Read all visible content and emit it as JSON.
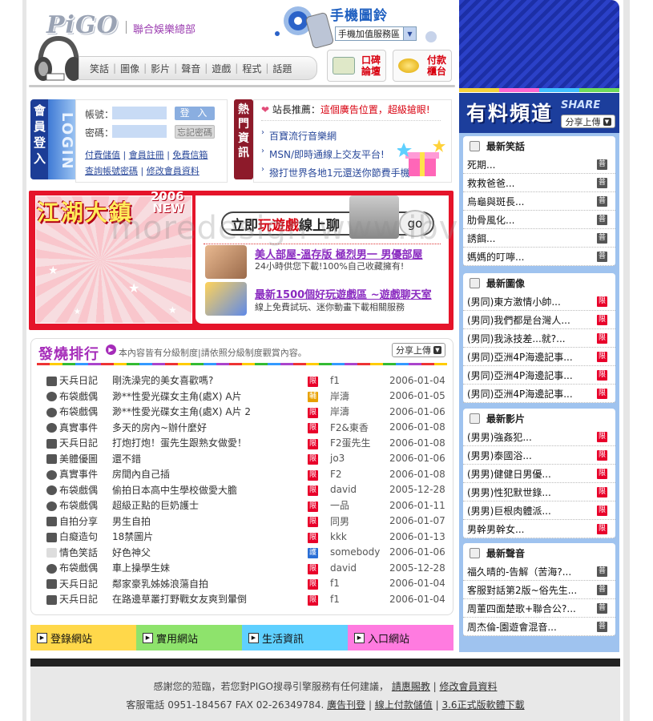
{
  "brand": {
    "logo": "PiGO",
    "tagline": "聯合娛樂總部"
  },
  "nav": [
    "笑話",
    "圖像",
    "影片",
    "聲音",
    "遊戲",
    "程式",
    "話題"
  ],
  "mobile": {
    "title": "手機圖鈴",
    "select": "手機加值服務區"
  },
  "header_buttons": [
    {
      "label": "口碑\n論壇"
    },
    {
      "label": "付款\n櫃台"
    }
  ],
  "login": {
    "vert_cn": "會員登入",
    "vert_en": "LOGIN",
    "account_label": "帳號：",
    "password_label": "密碼：",
    "login_btn": "登 入",
    "forgot_btn": "忘記密碼",
    "links_row1": [
      "付費儲值",
      "會員註冊",
      "免費信箱"
    ],
    "links_row2": [
      "查詢帳號密碼",
      "修改會員資料"
    ]
  },
  "hot": {
    "vert": "熱門資訊",
    "head_prefix": "站長推薦：",
    "head_red": "這個廣告位置，超級搶眼!",
    "items": [
      "百寶流行音樂網",
      "MSN/即時通線上交友平台!",
      "撥打世界各地1元還送你節費手機"
    ]
  },
  "jianghu": {
    "title": "江湖大鎮",
    "year": "2006",
    "new": "NEW",
    "slogan_pre": "立即",
    "slogan_red": "玩遊戲",
    "slogan_post": "線上聊",
    "go": "go",
    "watermark": "moredesign www.ibvvdm.us",
    "item1_title": "美人部屋-溫存版 極烈男一 男優部屋",
    "item1_sub": "24小時供您下載!100%自己收藏擁有!",
    "item2_title": "最新1500個好玩遊戲區 ~遊戲聊天室",
    "item2_sub": "線上免費試玩、迷你動畫下載相關服務"
  },
  "rank": {
    "title": "發燒排行",
    "note": "本內容皆有分級制度|請依照分級制度觀賞內容。",
    "share": "分享上傳",
    "rows": [
      {
        "cat": "天兵日記",
        "title": "剛洗澡完的美女喜歡嗎?",
        "tag": "限",
        "author": "f1",
        "date": "2006-01-04"
      },
      {
        "cat": "布袋戲偶",
        "title": "渺**性愛光碟女主角(處X) A片",
        "tag": "輔",
        "author": "岸濤",
        "date": "2006-01-05"
      },
      {
        "cat": "布袋戲偶",
        "title": "渺**性愛光碟女主角(處X) A片 2",
        "tag": "限",
        "author": "岸濤",
        "date": "2006-01-06"
      },
      {
        "cat": "真實事件",
        "title": "多天的房內~辦什麼好",
        "tag": "限",
        "author": "F2&東香",
        "date": "2006-01-08"
      },
      {
        "cat": "天兵日記",
        "title": "打炮打炮！蛋先生跟熟女做愛！",
        "tag": "限",
        "author": "F2蛋先生",
        "date": "2006-01-08"
      },
      {
        "cat": "美體優圖",
        "title": "還不錯",
        "tag": "限",
        "author": "jo3",
        "date": "2006-01-06"
      },
      {
        "cat": "真實事件",
        "title": "房間內自己插",
        "tag": "限",
        "author": "F2",
        "date": "2006-01-08"
      },
      {
        "cat": "布袋戲偶",
        "title": "偷拍日本高中生學校做愛大膽",
        "tag": "限",
        "author": "david",
        "date": "2005-12-28"
      },
      {
        "cat": "布袋戲偶",
        "title": "超級正點的巨奶護士",
        "tag": "限",
        "author": "一品",
        "date": "2006-01-11"
      },
      {
        "cat": "自拍分享",
        "title": "男生自拍",
        "tag": "限",
        "author": "同男",
        "date": "2006-01-07"
      },
      {
        "cat": "白癡造句",
        "title": "18禁圖片",
        "tag": "限",
        "author": "kkk",
        "date": "2006-01-13"
      },
      {
        "cat": "情色笑話",
        "title": "好色神父",
        "tag": "護",
        "author": "somebody",
        "date": "2006-01-06"
      },
      {
        "cat": "布袋戲偶",
        "title": "車上操學生妹",
        "tag": "限",
        "author": "david",
        "date": "2005-12-28"
      },
      {
        "cat": "天兵日記",
        "title": "鄰家豪乳姊姊浪蕩自拍",
        "tag": "限",
        "author": "f1",
        "date": "2006-01-04"
      },
      {
        "cat": "天兵日記",
        "title": "在路邊草叢打野戰女友爽到暈倒",
        "tag": "限",
        "author": "f1",
        "date": "2006-01-04"
      }
    ]
  },
  "link_bar": [
    "登錄網站",
    "實用網站",
    "生活資訊",
    "入口網站"
  ],
  "footer": {
    "line1_text": "感謝您的蒞臨，若您對PIGO搜尋引擎服務有任何建議，",
    "line1_links": [
      "請惠賜教",
      "修改會員資料"
    ],
    "line2_text": "客服電話 0951-184567  FAX 02-26349784.",
    "line2_links": [
      "廣告刊登",
      "線上付款儲值",
      "3.6正式版軟體下載"
    ]
  },
  "channel": {
    "title": "有料頻道",
    "share_en": "SHARE",
    "share": "分享上傳",
    "sections": [
      {
        "title": "最新笑話",
        "items": [
          {
            "t": "死期...",
            "tag": "普"
          },
          {
            "t": "救救爸爸...",
            "tag": "普"
          },
          {
            "t": "烏龜與斑長...",
            "tag": "普"
          },
          {
            "t": "肋骨風化...",
            "tag": "普"
          },
          {
            "t": "誘餌...",
            "tag": "普"
          },
          {
            "t": "媽媽的叮嚀...",
            "tag": "普"
          }
        ]
      },
      {
        "title": "最新圖像",
        "items": [
          {
            "t": "(男同)東方激情小帥...",
            "tag": "限"
          },
          {
            "t": "(男同)我們都是台灣人...",
            "tag": "限"
          },
          {
            "t": "(男同)我泳技差...就?...",
            "tag": "限"
          },
          {
            "t": "(男同)亞洲4P海邊記事...",
            "tag": "限"
          },
          {
            "t": "(男同)亞洲4P海邊記事...",
            "tag": "限"
          },
          {
            "t": "(男同)亞洲4P海邊記事...",
            "tag": "限"
          }
        ]
      },
      {
        "title": "最新影片",
        "items": [
          {
            "t": "(男男)強姦犯...",
            "tag": "限"
          },
          {
            "t": "(男男)泰國浴...",
            "tag": "限"
          },
          {
            "t": "(男男)健健日男優...",
            "tag": "限"
          },
          {
            "t": "(男男)性犯默世錄...",
            "tag": "限"
          },
          {
            "t": "(男男)巨根肉體派...",
            "tag": "限"
          },
          {
            "t": "男幹男幹女...",
            "tag": "限"
          }
        ]
      },
      {
        "title": "最新聲音",
        "items": [
          {
            "t": "福久晴的-告解（苦海?...",
            "tag": "普"
          },
          {
            "t": "客服對話第2版~俗先生...",
            "tag": "普"
          },
          {
            "t": "周董四面楚歌+聯合公?...",
            "tag": "普"
          },
          {
            "t": "周杰倫-園遊會混音...",
            "tag": "普"
          }
        ]
      }
    ]
  },
  "colors": {
    "brand_blue": "#1c3e9c",
    "accent_red": "#e5142a",
    "purple": "#a52bb9"
  }
}
